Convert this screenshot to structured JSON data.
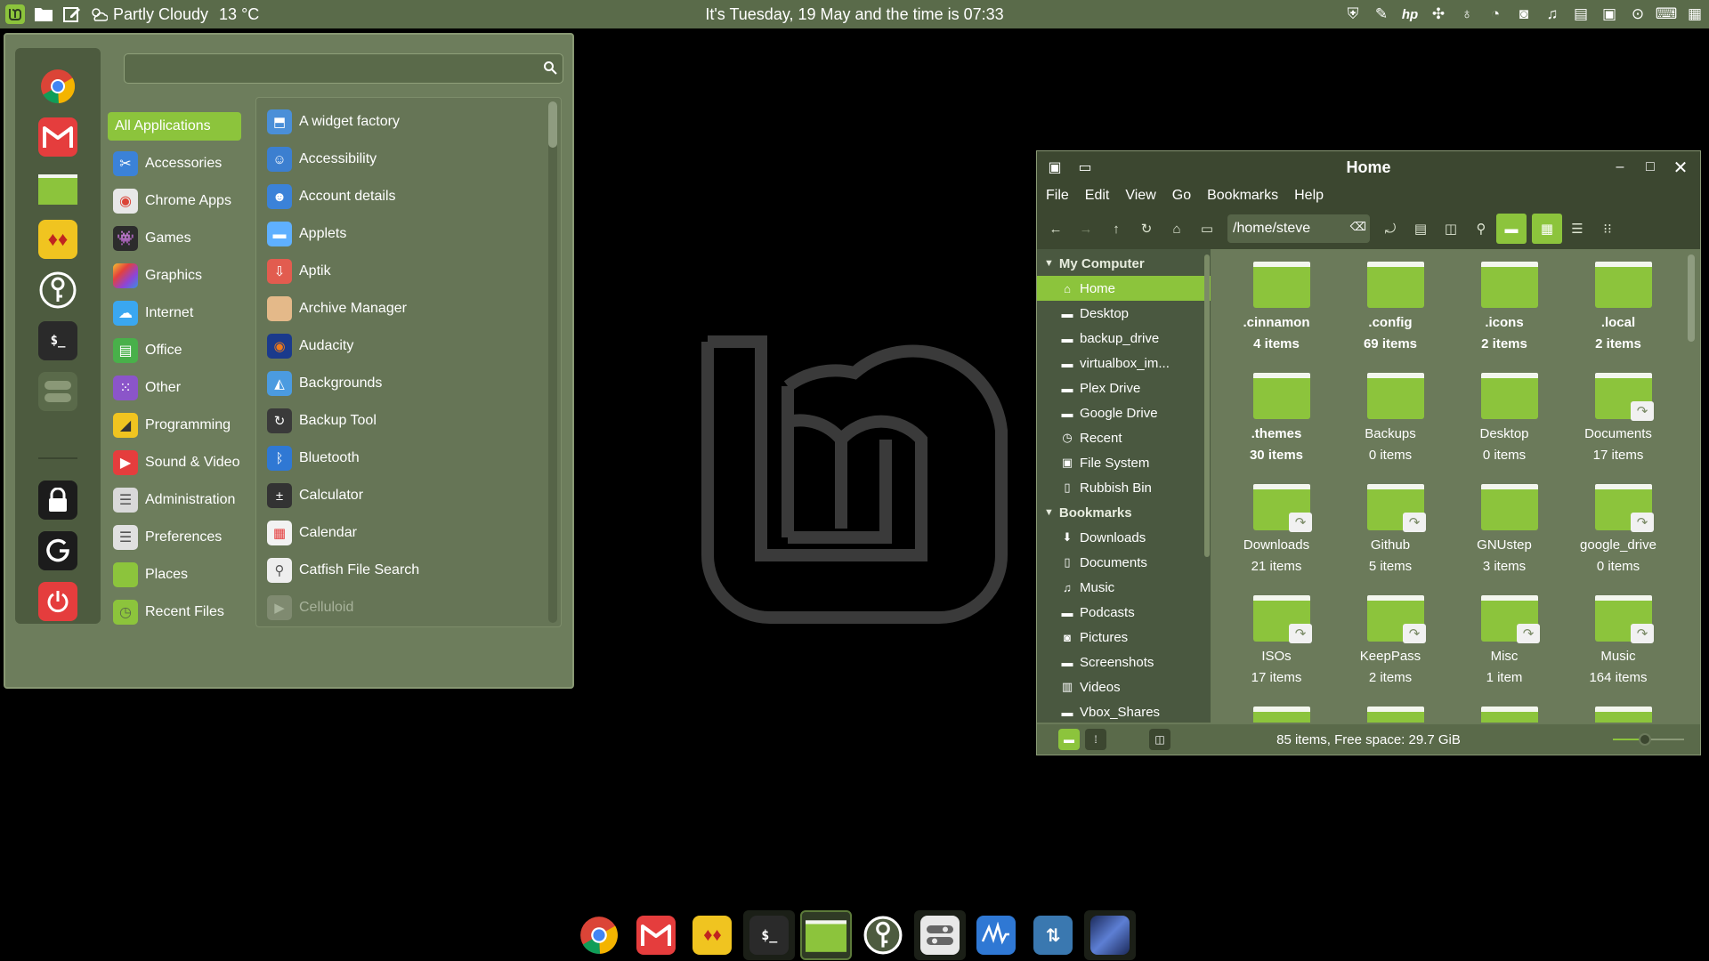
{
  "top_panel": {
    "weather_text": "Partly Cloudy",
    "temperature": "13 °C",
    "clock_text": "It's Tuesday, 19 May and the time is 07:33",
    "tray_icons": [
      "shield-icon",
      "paperclip-icon",
      "hp-icon",
      "network-icon",
      "bulb-icon",
      "vpn-icon",
      "camera-icon",
      "bell-icon",
      "printer-icon",
      "screenshot-icon",
      "settings-icon",
      "keyboard-icon",
      "notes-icon"
    ]
  },
  "start_menu": {
    "search_placeholder": "",
    "favorites": [
      "chrome-icon",
      "gmail-icon",
      "files-icon",
      "dice-icon",
      "keepass-icon",
      "terminal-icon",
      "toggle-icon",
      "lock-icon",
      "logout-icon",
      "power-icon"
    ],
    "categories": [
      {
        "label": "All Applications",
        "icon": "grid-icon",
        "color": "#8cc43c"
      },
      {
        "label": "Accessories",
        "icon": "scissors-icon",
        "color": "#3b82d8"
      },
      {
        "label": "Chrome Apps",
        "icon": "chrome-icon",
        "color": "#e8e8e8"
      },
      {
        "label": "Games",
        "icon": "game-icon",
        "color": "#2c2c2c"
      },
      {
        "label": "Graphics",
        "icon": "palette-icon",
        "color": "#c04ad6"
      },
      {
        "label": "Internet",
        "icon": "cloud-icon",
        "color": "#3aa7f0"
      },
      {
        "label": "Office",
        "icon": "office-icon",
        "color": "#49b04a"
      },
      {
        "label": "Other",
        "icon": "grid-dots-icon",
        "color": "#8b55c9"
      },
      {
        "label": "Programming",
        "icon": "chart-icon",
        "color": "#f0c420"
      },
      {
        "label": "Sound & Video",
        "icon": "play-icon",
        "color": "#e53d3d"
      },
      {
        "label": "Administration",
        "icon": "admin-icon",
        "color": "#d9d9d9"
      },
      {
        "label": "Preferences",
        "icon": "prefs-icon",
        "color": "#e0e0e0"
      },
      {
        "label": "Places",
        "icon": "folder-icon",
        "color": "#8cc43c"
      },
      {
        "label": "Recent Files",
        "icon": "recent-icon",
        "color": "#8cc43c"
      }
    ],
    "applications": [
      {
        "label": "A widget factory",
        "icon": "widget-icon",
        "color": "#4a8fd8"
      },
      {
        "label": "Accessibility",
        "icon": "accessibility-icon",
        "color": "#3c7fd0"
      },
      {
        "label": "Account details",
        "icon": "account-icon",
        "color": "#3b82d8"
      },
      {
        "label": "Applets",
        "icon": "applets-icon",
        "color": "#5fb0ff"
      },
      {
        "label": "Aptik",
        "icon": "aptik-icon",
        "color": "#e25c4f"
      },
      {
        "label": "Archive Manager",
        "icon": "archive-icon",
        "color": "#e4b989"
      },
      {
        "label": "Audacity",
        "icon": "audacity-icon",
        "color": "#1a3a8c"
      },
      {
        "label": "Backgrounds",
        "icon": "backgrounds-icon",
        "color": "#4b9be0"
      },
      {
        "label": "Backup Tool",
        "icon": "backup-icon",
        "color": "#3a3a3a"
      },
      {
        "label": "Bluetooth",
        "icon": "bluetooth-icon",
        "color": "#2f78d4"
      },
      {
        "label": "Calculator",
        "icon": "calculator-icon",
        "color": "#333333"
      },
      {
        "label": "Calendar",
        "icon": "calendar-icon",
        "color": "#f2f2f2"
      },
      {
        "label": "Catfish File Search",
        "icon": "catfish-icon",
        "color": "#eeeeee"
      },
      {
        "label": "Celluloid",
        "icon": "celluloid-icon",
        "color": "#7f8a70"
      }
    ]
  },
  "file_manager": {
    "title": "Home",
    "menus": [
      "File",
      "Edit",
      "View",
      "Go",
      "Bookmarks",
      "Help"
    ],
    "path": "/home/steve",
    "sidebar": {
      "my_computer_label": "My Computer",
      "bookmarks_label": "Bookmarks",
      "computer_items": [
        {
          "label": "Home",
          "icon": "home-icon"
        },
        {
          "label": "Desktop",
          "icon": "folder-icon"
        },
        {
          "label": "backup_drive",
          "icon": "folder-icon"
        },
        {
          "label": "virtualbox_im...",
          "icon": "folder-icon"
        },
        {
          "label": "Plex Drive",
          "icon": "folder-icon"
        },
        {
          "label": "Google Drive",
          "icon": "folder-icon"
        },
        {
          "label": "Recent",
          "icon": "clock-icon"
        },
        {
          "label": "File System",
          "icon": "drive-icon"
        },
        {
          "label": "Rubbish Bin",
          "icon": "trash-icon"
        }
      ],
      "bookmark_items": [
        {
          "label": "Downloads",
          "icon": "download-icon"
        },
        {
          "label": "Documents",
          "icon": "document-icon"
        },
        {
          "label": "Music",
          "icon": "music-icon"
        },
        {
          "label": "Podcasts",
          "icon": "folder-icon"
        },
        {
          "label": "Pictures",
          "icon": "camera-icon"
        },
        {
          "label": "Screenshots",
          "icon": "folder-icon"
        },
        {
          "label": "Videos",
          "icon": "film-icon"
        },
        {
          "label": "Vbox_Shares",
          "icon": "folder-icon"
        }
      ]
    },
    "files": [
      {
        "name": ".cinnamon",
        "count": "4 items",
        "hidden": true,
        "link": false
      },
      {
        "name": ".config",
        "count": "69 items",
        "hidden": true,
        "link": false
      },
      {
        "name": ".icons",
        "count": "2 items",
        "hidden": true,
        "link": false
      },
      {
        "name": ".local",
        "count": "2 items",
        "hidden": true,
        "link": false
      },
      {
        "name": ".themes",
        "count": "30 items",
        "hidden": true,
        "link": false
      },
      {
        "name": "Backups",
        "count": "0 items",
        "hidden": false,
        "link": false
      },
      {
        "name": "Desktop",
        "count": "0 items",
        "hidden": false,
        "link": false
      },
      {
        "name": "Documents",
        "count": "17 items",
        "hidden": false,
        "link": true
      },
      {
        "name": "Downloads",
        "count": "21 items",
        "hidden": false,
        "link": true
      },
      {
        "name": "Github",
        "count": "5 items",
        "hidden": false,
        "link": true
      },
      {
        "name": "GNUstep",
        "count": "3 items",
        "hidden": false,
        "link": false
      },
      {
        "name": "google_drive",
        "count": "0 items",
        "hidden": false,
        "link": true
      },
      {
        "name": "ISOs",
        "count": "17 items",
        "hidden": false,
        "link": true
      },
      {
        "name": "KeepPass",
        "count": "2 items",
        "hidden": false,
        "link": true
      },
      {
        "name": "Misc",
        "count": "1 item",
        "hidden": false,
        "link": true
      },
      {
        "name": "Music",
        "count": "164 items",
        "hidden": false,
        "link": true
      }
    ],
    "status_text": "85 items, Free space: 29.7 GiB",
    "zoom_level": 0.45
  },
  "dock": {
    "items": [
      {
        "name": "chrome-icon",
        "color": "#e8e8e8",
        "state": "normal"
      },
      {
        "name": "gmail-icon",
        "color": "#e53d3d",
        "state": "normal"
      },
      {
        "name": "dice-icon",
        "color": "#f0c420",
        "state": "normal"
      },
      {
        "name": "terminal-icon",
        "color": "#2a2a2a",
        "state": "running"
      },
      {
        "name": "files-icon",
        "color": "#8cc43c",
        "state": "active"
      },
      {
        "name": "keepass-icon",
        "color": "#4d5b3f",
        "state": "normal"
      },
      {
        "name": "settings-toggle-icon",
        "color": "#e8e8e8",
        "state": "running"
      },
      {
        "name": "monitor-icon",
        "color": "#2f78d4",
        "state": "normal"
      },
      {
        "name": "updater-icon",
        "color": "#3a78b0",
        "state": "normal"
      },
      {
        "name": "workspace-icon",
        "color": "#3b5fb0",
        "state": "running"
      }
    ]
  }
}
